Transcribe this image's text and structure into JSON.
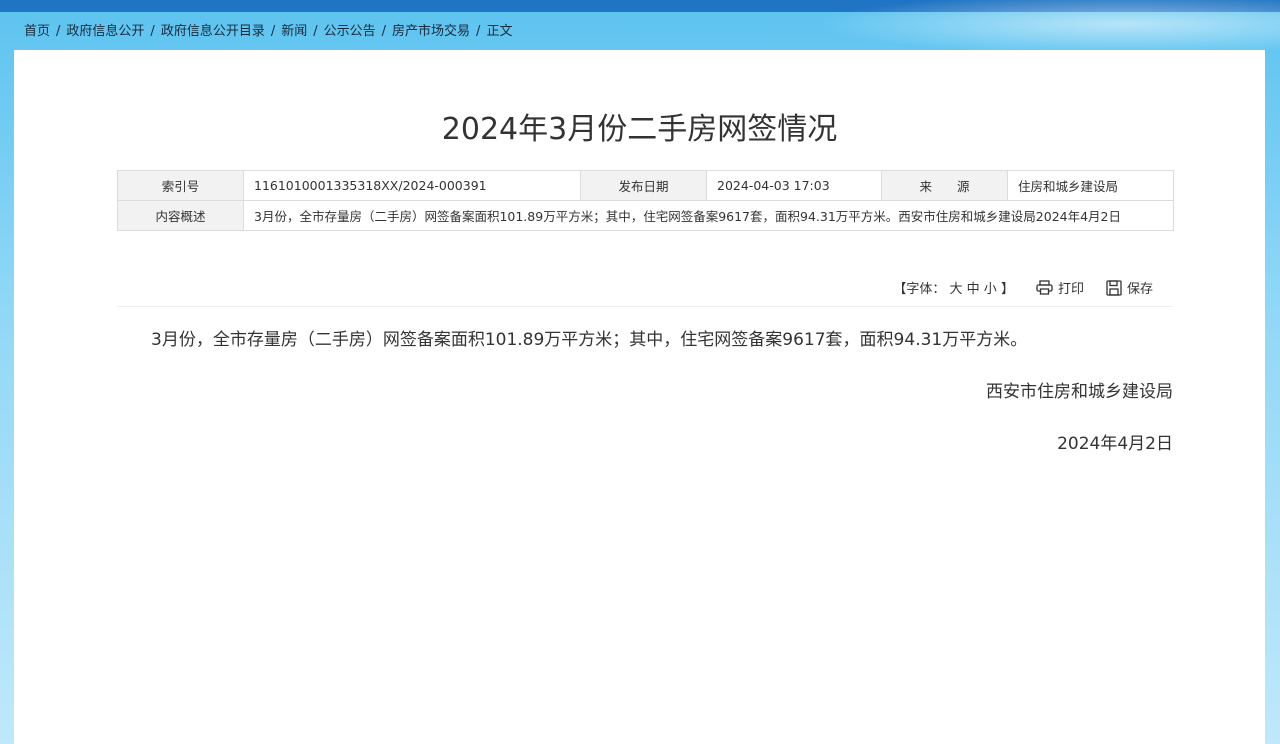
{
  "breadcrumb": [
    {
      "label": "首页"
    },
    {
      "label": "政府信息公开"
    },
    {
      "label": "政府信息公开目录"
    },
    {
      "label": "新闻"
    },
    {
      "label": "公示公告"
    },
    {
      "label": "房产市场交易"
    },
    {
      "label": "正文"
    }
  ],
  "breadcrumb_sep": "/",
  "article": {
    "title": "2024年3月份二手房网签情况",
    "meta": {
      "index_label": "索引号",
      "index_value": "1161010001335318XX/2024-000391",
      "date_label": "发布日期",
      "date_value": "2024-04-03 17:03",
      "source_label": "来　　源",
      "source_value": "住房和城乡建设局",
      "summary_label": "内容概述",
      "summary_value": "3月份，全市存量房（二手房）网签备案面积101.89万平方米；其中，住宅网签备案9617套，面积94.31万平方米。西安市住房和城乡建设局2024年4月2日"
    },
    "tools": {
      "font_prefix": "【字体：",
      "font_large": "大",
      "font_medium": "中",
      "font_small": "小",
      "font_suffix": "】",
      "print_label": "打印",
      "save_label": "保存",
      "print_icon": "printer-icon",
      "save_icon": "floppy-disk-icon"
    },
    "body": "3月份，全市存量房（二手房）网签备案面积101.89万平方米；其中，住宅网签备案9617套，面积94.31万平方米。",
    "signature": "西安市住房和城乡建设局",
    "sign_date": "2024年4月2日"
  },
  "colors": {
    "topbar": "#1f74c4",
    "table_label_bg": "#f2f2f2",
    "border": "#dcdcdc"
  }
}
